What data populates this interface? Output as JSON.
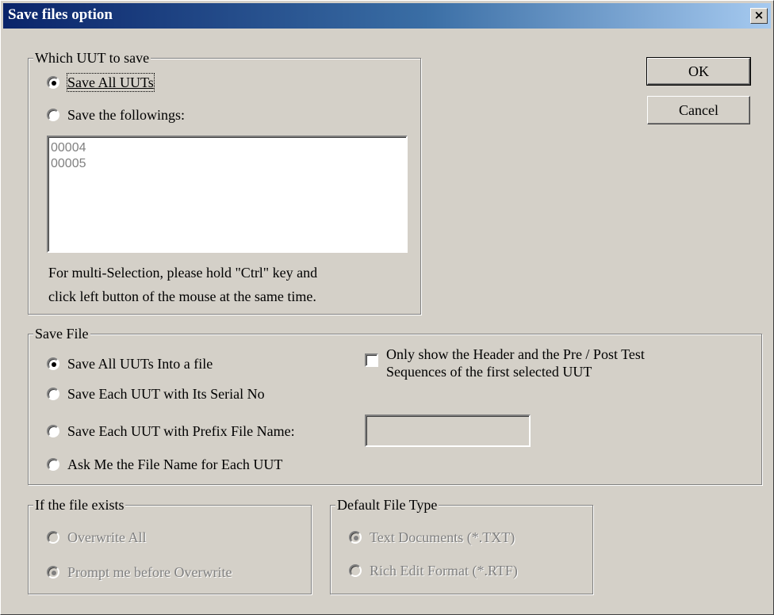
{
  "dialog": {
    "title": "Save files option",
    "close_label": "×"
  },
  "buttons": {
    "ok_label": "OK",
    "cancel_label": "Cancel"
  },
  "which_uut": {
    "legend": "Which UUT to save",
    "options": [
      {
        "label": "Save All UUTs",
        "checked": true
      },
      {
        "label": "Save the followings:",
        "checked": false
      }
    ],
    "list_items": [
      "00004",
      "00005"
    ],
    "hint_line1": "For multi-Selection, please hold \"Ctrl\" key and",
    "hint_line2": "click left button of the mouse at the same time."
  },
  "save_file": {
    "legend": "Save File",
    "options": [
      {
        "label": "Save All UUTs Into a file",
        "checked": true
      },
      {
        "label": "Save Each UUT with Its Serial No",
        "checked": false
      },
      {
        "label": "Save Each UUT with Prefix File Name:",
        "checked": false
      },
      {
        "label": "Ask Me the File Name for Each UUT",
        "checked": false
      }
    ],
    "prefix_value": "",
    "only_header_line1": "Only show the Header and the Pre / Post Test",
    "only_header_line2": "Sequences of the first selected UUT",
    "only_header_checked": false
  },
  "file_exists": {
    "legend": "If the file exists",
    "options": [
      {
        "label": "Overwrite All",
        "checked": false
      },
      {
        "label": "Prompt me before Overwrite",
        "checked": true
      }
    ]
  },
  "file_type": {
    "legend": "Default File Type",
    "options": [
      {
        "label": "Text Documents (*.TXT)",
        "checked": true
      },
      {
        "label": "Rich Edit Format (*.RTF)",
        "checked": false
      }
    ]
  }
}
